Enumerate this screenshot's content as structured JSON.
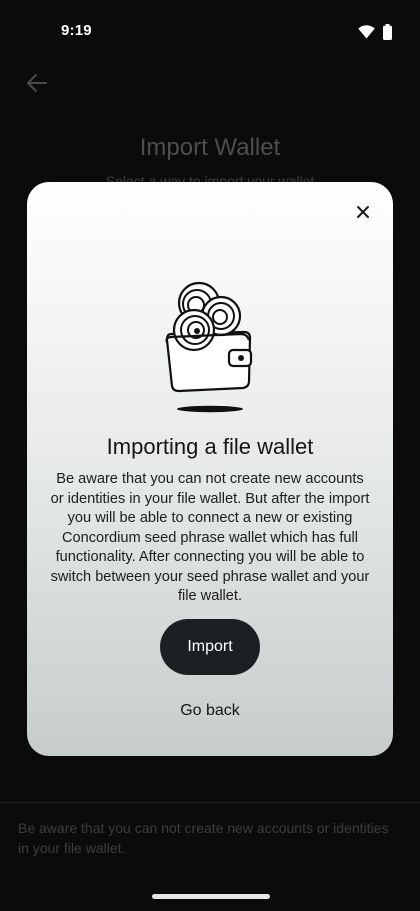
{
  "status_bar": {
    "time": "9:19",
    "icons": [
      "wifi-icon",
      "battery-icon"
    ]
  },
  "background_screen": {
    "back_icon": "arrow-left-icon",
    "title": "Import Wallet",
    "subtitle": "Select a way to import your wallet",
    "footer_note": "Be aware that you can not create new accounts or identities in your file wallet."
  },
  "dialog": {
    "close_icon": "close-icon",
    "illustration": "wallet-with-coins-illustration",
    "title": "Importing a file wallet",
    "body": "Be aware that you can not create new accounts or identities in your file wallet. But after the import you will be able to connect a new or existing Concordium seed phrase wallet which has full functionality. After connecting you will be able to switch between your seed phrase wallet and your file wallet.",
    "primary_button": "Import",
    "secondary_button": "Go back"
  },
  "colors": {
    "page_background": "#0b0b0b",
    "dialog_top": "#ffffff",
    "dialog_bottom": "#c6cdcc",
    "primary_button": "#1c2022"
  }
}
